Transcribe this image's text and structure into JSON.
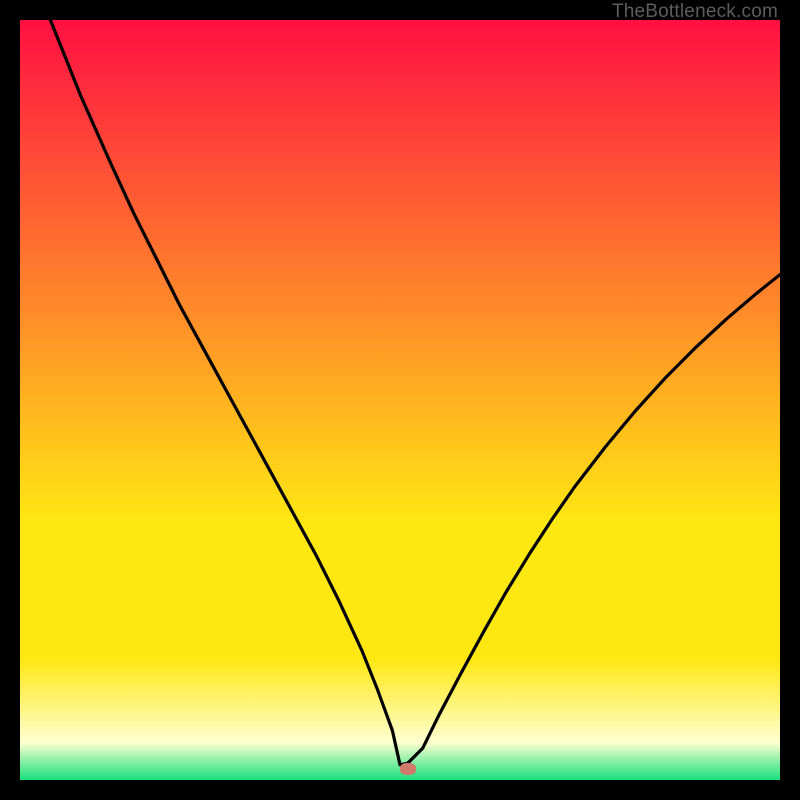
{
  "watermark": {
    "text": "TheBottleneck.com"
  },
  "chart_data": {
    "type": "line",
    "title": "",
    "xlabel": "",
    "ylabel": "",
    "xlim": [
      0,
      100
    ],
    "ylim": [
      0,
      100
    ],
    "grid": false,
    "legend": false,
    "colors": {
      "curve": "#000000",
      "marker": "#cf7a6d",
      "gradient_top": "#ff1042",
      "gradient_mid_orange": "#ff8a2a",
      "gradient_mid_yellow": "#ffe712",
      "gradient_pale": "#ffffd0",
      "gradient_green": "#18e07e"
    },
    "marker_xy": [
      51,
      1.5
    ],
    "series": [
      {
        "name": "bottleneck-curve",
        "x": [
          4,
          6,
          8,
          10,
          12,
          15,
          18,
          21,
          24,
          27,
          30,
          33,
          36,
          39,
          42,
          45,
          47,
          49,
          50,
          51,
          53,
          55,
          58,
          61,
          64,
          67,
          70,
          73,
          77,
          81,
          85,
          89,
          93,
          97,
          100
        ],
        "y": [
          100,
          95,
          90,
          85.5,
          81,
          74.5,
          68.5,
          62.5,
          57,
          51.5,
          46,
          40.5,
          35,
          29.5,
          23.5,
          17,
          12,
          6.5,
          2,
          2.2,
          4.2,
          8.3,
          14,
          19.5,
          24.8,
          29.7,
          34.3,
          38.6,
          43.8,
          48.6,
          53,
          57,
          60.7,
          64.1,
          66.5
        ]
      }
    ]
  }
}
